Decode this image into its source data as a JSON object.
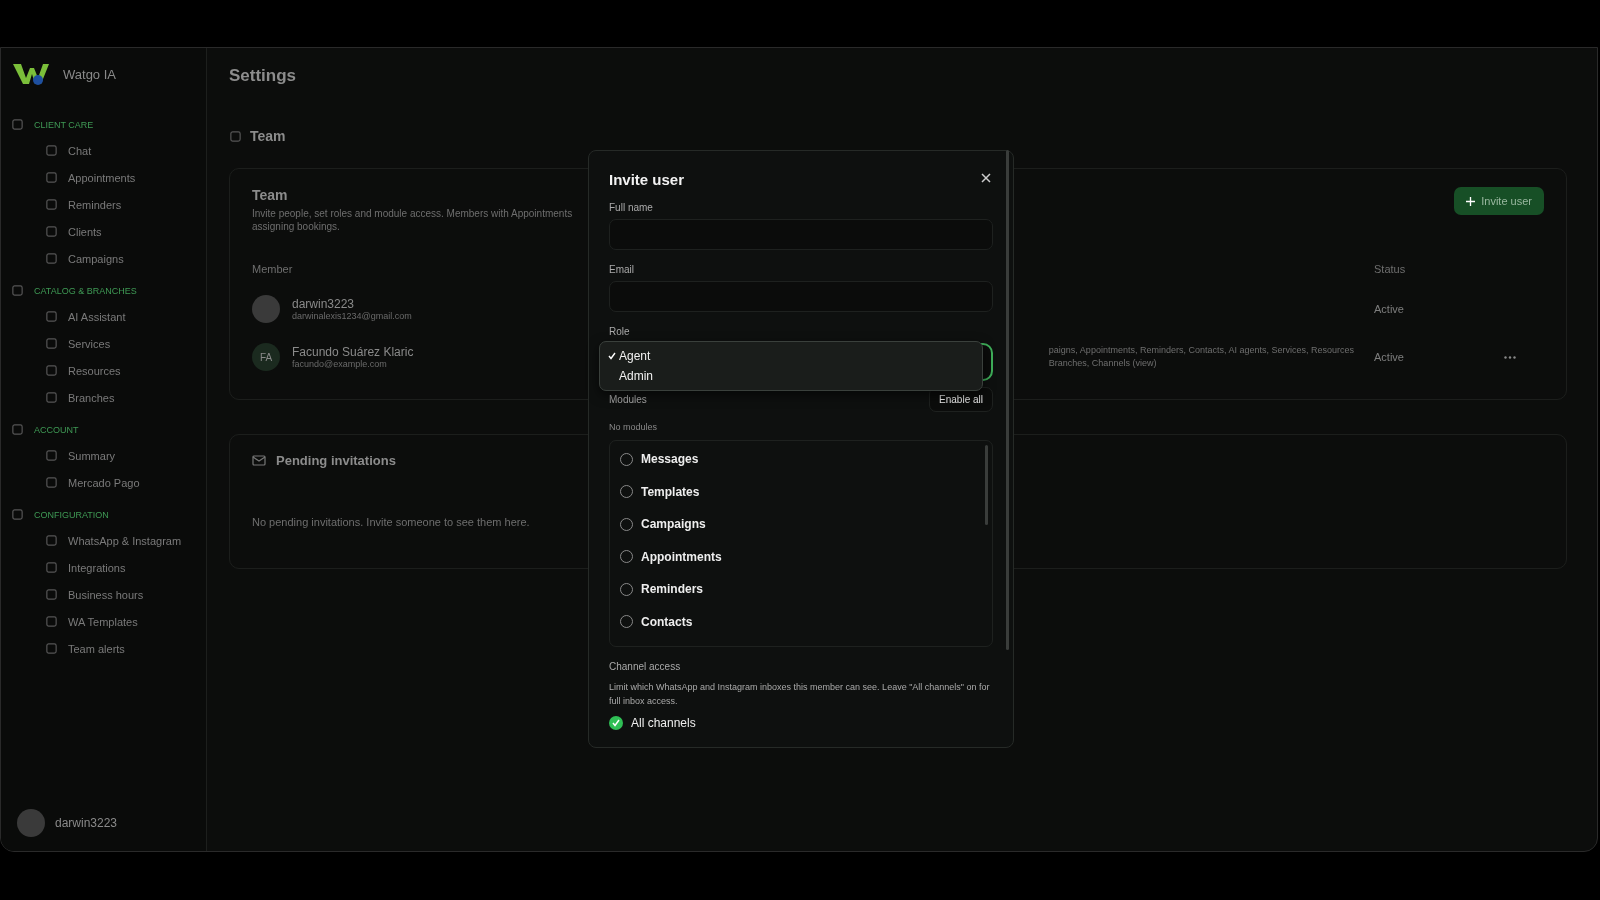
{
  "sidebar": {
    "brand": "Watgo IA",
    "sections": [
      {
        "title": "CLIENT CARE",
        "items": [
          {
            "label": "Chat"
          },
          {
            "label": "Appointments"
          },
          {
            "label": "Reminders"
          },
          {
            "label": "Clients"
          },
          {
            "label": "Campaigns"
          }
        ]
      },
      {
        "title": "CATALOG & BRANCHES",
        "items": [
          {
            "label": "AI Assistant"
          },
          {
            "label": "Services"
          },
          {
            "label": "Resources"
          },
          {
            "label": "Branches"
          }
        ]
      },
      {
        "title": "ACCOUNT",
        "items": [
          {
            "label": "Summary"
          },
          {
            "label": "Mercado Pago"
          }
        ]
      },
      {
        "title": "CONFIGURATION",
        "items": [
          {
            "label": "WhatsApp & Instagram"
          },
          {
            "label": "Integrations"
          },
          {
            "label": "Business hours"
          },
          {
            "label": "WA Templates"
          },
          {
            "label": "Team alerts"
          }
        ]
      }
    ],
    "user": {
      "name": "darwin3223"
    }
  },
  "page": {
    "title": "Settings",
    "section": "Team",
    "team_card": {
      "title": "Team",
      "description_lines": [
        "Invite people, set roles and module access. Members with Appointments",
        "assigning bookings."
      ],
      "invite_button": "Invite user"
    },
    "table": {
      "columns": [
        "Member",
        "Status"
      ],
      "rows": [
        {
          "name": "darwin3223",
          "email": "darwinalexis1234@gmail.com",
          "avatar": {
            "kind": "photo"
          },
          "modules_lines": [],
          "status": "Active",
          "menu": false
        },
        {
          "name": "Facundo Suárez Klaric",
          "email": "facundo@example.com",
          "avatar": {
            "kind": "initials",
            "text": "FA"
          },
          "modules_lines": [
            "paigns, Appointments, Reminders, Contacts, AI agents, Services, Resources",
            "Branches, Channels (view)"
          ],
          "status": "Active",
          "menu": true
        }
      ]
    },
    "pending": {
      "title": "Pending invitations",
      "empty": "No pending invitations. Invite someone to see them here."
    }
  },
  "dialog": {
    "title": "Invite user",
    "fields": [
      {
        "label": "Full name"
      },
      {
        "label": "Email"
      }
    ],
    "role": {
      "label": "Role",
      "options": [
        {
          "label": "Agent",
          "selected": true
        },
        {
          "label": "Admin",
          "selected": false
        }
      ]
    },
    "modules": {
      "label": "Modules",
      "enable_all": "Enable all",
      "hint": "No modules",
      "items": [
        {
          "label": "Messages",
          "checked": false
        },
        {
          "label": "Templates",
          "checked": false
        },
        {
          "label": "Campaigns",
          "checked": false
        },
        {
          "label": "Appointments",
          "checked": false
        },
        {
          "label": "Reminders",
          "checked": false
        },
        {
          "label": "Contacts",
          "checked": false
        }
      ]
    },
    "channels": {
      "label": "Channel access",
      "description": "Limit which WhatsApp and Instagram inboxes this member can see. Leave \"All channels\" on for full inbox access.",
      "all": {
        "label": "All channels",
        "checked": true
      }
    }
  }
}
